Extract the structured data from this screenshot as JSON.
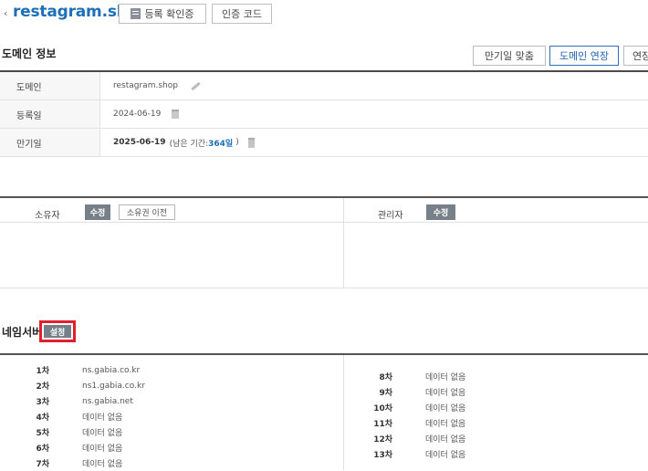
{
  "header": {
    "back": "‹",
    "domain": "restagram.shop",
    "cert_button": "등록 확인증",
    "auth_button": "인증 코드"
  },
  "domain_info": {
    "title": "도메인 정보",
    "buttons": [
      "만기일 맞춤",
      "도메인 연장",
      "연장"
    ],
    "rows": [
      {
        "label": "도메인",
        "value": "restagram.shop"
      },
      {
        "label": "등록일",
        "value": "2024-06-19"
      },
      {
        "label": "만기일",
        "value": "2025-06-19",
        "remain_prefix": "(남은 기간: ",
        "remain_days": "364일",
        "remain_suffix": ")"
      }
    ]
  },
  "owner": {
    "owner_label": "소유자",
    "edit": "수정",
    "transfer": "소유권 이전",
    "admin_label": "관리자",
    "admin_edit": "수정"
  },
  "nameserver": {
    "title": "네임서버",
    "setup": "설정",
    "left": [
      {
        "k": "1차",
        "v": "ns.gabia.co.kr"
      },
      {
        "k": "2차",
        "v": "ns1.gabia.co.kr"
      },
      {
        "k": "3차",
        "v": "ns.gabia.net"
      },
      {
        "k": "4차",
        "v": "데이터 없음"
      },
      {
        "k": "5차",
        "v": "데이터 없음"
      },
      {
        "k": "6차",
        "v": "데이터 없음"
      },
      {
        "k": "7차",
        "v": "데이터 없음"
      }
    ],
    "right": [
      {
        "k": "8차",
        "v": "데이터 없음"
      },
      {
        "k": "9차",
        "v": "데이터 없음"
      },
      {
        "k": "10차",
        "v": "데이터 없음"
      },
      {
        "k": "11차",
        "v": "데이터 없음"
      },
      {
        "k": "12차",
        "v": "데이터 없음"
      },
      {
        "k": "13차",
        "v": "데이터 없음"
      }
    ]
  },
  "colors": {
    "accent": "#1d6fb8",
    "highlight": "#e0202c"
  }
}
